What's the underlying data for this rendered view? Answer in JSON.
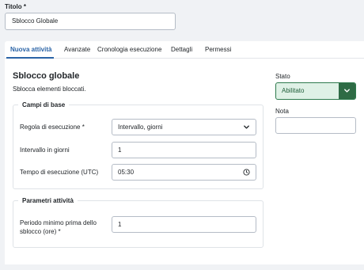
{
  "title_field": {
    "label": "Titolo *",
    "value": "Sblocco Globale"
  },
  "tabs": [
    {
      "label": "Nuova attività"
    },
    {
      "label": "Avanzate"
    },
    {
      "label": "Cronologia esecuzione"
    },
    {
      "label": "Dettagli"
    },
    {
      "label": "Permessi"
    }
  ],
  "main": {
    "heading": "Sblocco globale",
    "description": "Sblocca elementi bloccati.",
    "basic_fields": {
      "legend": "Campi di base",
      "rule_label": "Regola di esecuzione *",
      "rule_value": "Intervallo, giorni",
      "interval_label": "Intervallo in giorni",
      "interval_value": "1",
      "time_label": "Tempo di esecuzione (UTC)",
      "time_value": "05:30"
    },
    "task_params": {
      "legend": "Parametri attività",
      "min_period_label_line1": "Periodo minimo prima dello",
      "min_period_label_line2": "sblocco (ore) *",
      "min_period_value": "1"
    }
  },
  "sidebar": {
    "status_label": "Stato",
    "status_value": "Abilitato",
    "note_label": "Nota",
    "note_value": ""
  },
  "colors": {
    "accent": "#2a63a6",
    "status_bg": "#dff1e6",
    "status_border": "#2e7a4d",
    "status_button": "#2e6b45"
  },
  "icons": {
    "rule_select": "chevron-down-icon",
    "status_select": "chevron-down-icon",
    "time_input": "clock-icon"
  }
}
